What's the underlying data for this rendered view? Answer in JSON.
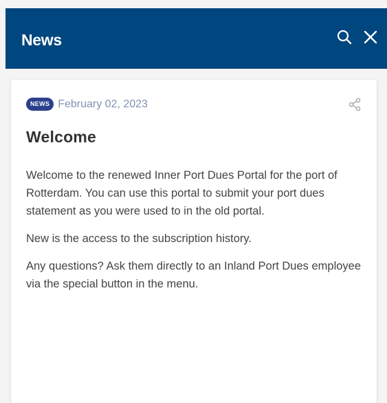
{
  "header": {
    "title": "News",
    "search_icon": "search-icon",
    "close_icon": "close-icon",
    "background_color": "#00467f"
  },
  "article": {
    "badge": "NEWS",
    "date": "February 02, 2023",
    "share_icon": "share-icon",
    "title": "Welcome",
    "paragraphs": [
      "Welcome to the renewed Inner Port Dues Portal for the port of Rotterdam. You can use this portal to submit your port dues statement as you were used to in the old portal.",
      "New is the access to the subscription history.",
      "Any questions? Ask them directly to an Inland Port Dues employee via the special button in the menu."
    ]
  }
}
